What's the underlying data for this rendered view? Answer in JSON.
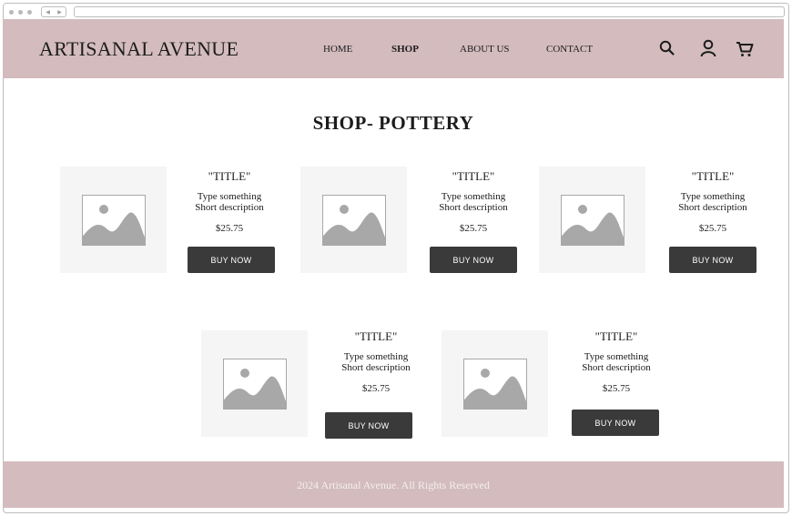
{
  "brand": "ARTISANAL AVENUE",
  "nav": {
    "home": "HOME",
    "shop": "SHOP",
    "about": "ABOUT US",
    "contact": "CONTACT"
  },
  "page_title": "SHOP- POTTERY",
  "products": [
    {
      "title": "\"TITLE\"",
      "desc1": "Type something",
      "desc2": "Short description",
      "price": "$25.75",
      "button": "BUY NOW"
    },
    {
      "title": "\"TITLE\"",
      "desc1": "Type something",
      "desc2": "Short description",
      "price": "$25.75",
      "button": "BUY NOW"
    },
    {
      "title": "\"TITLE\"",
      "desc1": "Type something",
      "desc2": "Short description",
      "price": "$25.75",
      "button": "BUY NOW"
    },
    {
      "title": "\"TITLE\"",
      "desc1": "Type something",
      "desc2": "Short description",
      "price": "$25.75",
      "button": "BUY NOW"
    },
    {
      "title": "\"TITLE\"",
      "desc1": "Type something",
      "desc2": "Short description",
      "price": "$25.75",
      "button": "BUY NOW"
    }
  ],
  "icons": {
    "search": "search-icon",
    "account": "user-icon",
    "cart": "cart-icon",
    "product_image": "image-placeholder-icon"
  },
  "colors": {
    "header_bg": "#d3bbbe",
    "footer_bg": "#d3bbbe",
    "button_bg": "#3a3a3a",
    "image_bg": "#f5f5f5"
  },
  "footer": "2024 Artisanal Avenue. All Rights Reserved"
}
